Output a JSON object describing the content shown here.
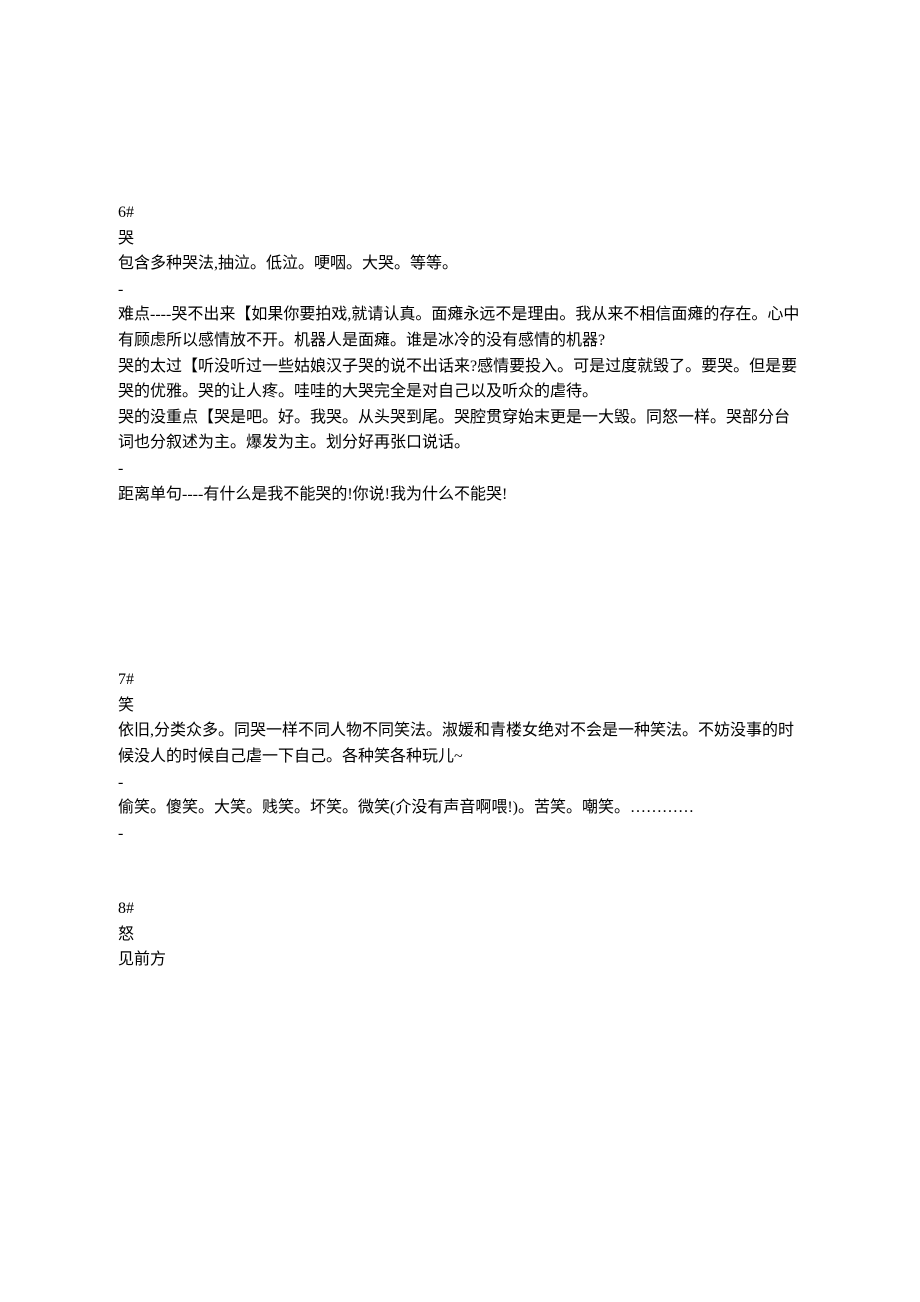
{
  "sections": [
    {
      "id": "6",
      "lines": [
        "6#",
        "哭",
        "包含多种哭法,抽泣。低泣。哽咽。大哭。等等。",
        "-",
        "难点----哭不出来【如果你要拍戏,就请认真。面瘫永远不是理由。我从来不相信面瘫的存在。心中有顾虑所以感情放不开。机器人是面瘫。谁是冰冷的没有感情的机器?",
        "哭的太过【听没听过一些姑娘汉子哭的说不出话来?感情要投入。可是过度就毁了。要哭。但是要哭的优雅。哭的让人疼。哇哇的大哭完全是对自己以及听众的虐待。",
        "哭的没重点【哭是吧。好。我哭。从头哭到尾。哭腔贯穿始末更是一大毁。同怒一样。哭部分台词也分叙述为主。爆发为主。划分好再张口说话。",
        "-",
        "距离单句----有什么是我不能哭的!你说!我为什么不能哭!"
      ]
    },
    {
      "id": "7",
      "lines": [
        "7#",
        "笑",
        "依旧,分类众多。同哭一样不同人物不同笑法。淑媛和青楼女绝对不会是一种笑法。不妨没事的时候没人的时候自己虐一下自己。各种笑各种玩儿~",
        "-",
        "偷笑。傻笑。大笑。贱笑。坏笑。微笑(介没有声音啊喂!)。苦笑。嘲笑。…………",
        "-"
      ]
    },
    {
      "id": "8",
      "lines": [
        "8#",
        "怒",
        "见前方"
      ]
    }
  ]
}
